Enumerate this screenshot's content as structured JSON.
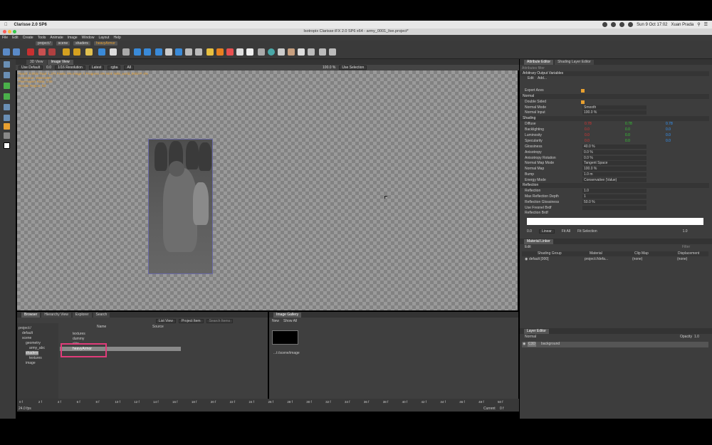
{
  "mac": {
    "app_name": "Clarisse 2.0 SP6",
    "menu": [
      "File",
      "Edit",
      "Create",
      "Tools",
      "Animate",
      "Image",
      "Window",
      "Layout",
      "Help"
    ],
    "clock": "Sun 9 Oct  17:02",
    "user": "Xuan Prada"
  },
  "window": {
    "title": "Isotropix Clarisse iFX 2.0 SP6 x64  -  army_0001_live.project*"
  },
  "pathbar": {
    "segments": [
      "project:/",
      "scene",
      "shaders"
    ],
    "current": "heavyArmor"
  },
  "viewer": {
    "tabs": [
      "3D View",
      "Image View"
    ],
    "options": [
      "Use Default",
      "0.0",
      "1/16 Resolution",
      "Latest",
      "rgba",
      "All"
    ],
    "zoom": "100.0 %",
    "selection": "Use Selection",
    "overlay_lines": [
      "Rendr: 0.003s Total: 1.37s Pixels: 0% Image: 0 Progress: 0% Hint: hello_world_0003 P: 0%",
      "Resolution: 1920x1080",
      "Pixel Aspect Ratio: 1.00",
      "Render Region: full"
    ]
  },
  "browser": {
    "tabs": [
      "Browser",
      "Hierarchy View",
      "Explorer",
      "Search"
    ],
    "view_mode": "List View",
    "filter": "Project Item",
    "search_placeholder": "Search Items",
    "columns": [
      "Name",
      "Source"
    ],
    "tree": [
      {
        "label": "project:/",
        "indent": 0
      },
      {
        "label": "default",
        "indent": 1
      },
      {
        "label": "scene",
        "indent": 1
      },
      {
        "label": "geometry",
        "indent": 2
      },
      {
        "label": "army_abc",
        "indent": 3
      },
      {
        "label": "shaders",
        "indent": 2,
        "selected": true
      },
      {
        "label": "textures",
        "indent": 3
      },
      {
        "label": "image",
        "indent": 2
      }
    ],
    "items": [
      {
        "name": "textures",
        "selected": false
      },
      {
        "name": "dummy",
        "selected": false
      },
      {
        "name": "skin",
        "selected": false
      },
      {
        "name": "heavyArmor",
        "selected": true
      }
    ]
  },
  "gallery": {
    "tab": "Image Gallery",
    "new_label": "New",
    "show_label": "Show All",
    "thumb_caption": "...t:/scene/image"
  },
  "timeline": {
    "ticks": [
      "0 f",
      "2 f",
      "4 f",
      "6 f",
      "8 f",
      "10 f",
      "12 f",
      "14 f",
      "16 f",
      "18 f",
      "20 f",
      "22 f",
      "24 f",
      "26 f",
      "28 f",
      "30 f",
      "32 f",
      "34 f",
      "36 f",
      "38 f",
      "40 f",
      "42 f",
      "44 f",
      "46 f",
      "48 f",
      "50 f"
    ],
    "fps": "24.0 fps",
    "start": "0 f",
    "end": "50 f",
    "current_label": "Current",
    "current_value": "0 f"
  },
  "attr_editor": {
    "tabs": [
      "Attribute Editor",
      "Shading Layer Editor"
    ],
    "filter_placeholder": "Attributes filter",
    "sections": {
      "arbitrary": "Arbitrary Output Variables",
      "edit": "Edit",
      "add": "Add...",
      "export": "Export Aovs",
      "normal": "Normal",
      "shading": "Shading",
      "reflection": "Reflection",
      "reflection_brdf": "Reflection Brdf"
    },
    "normal_rows": [
      {
        "label": "Double Sided",
        "value": ""
      },
      {
        "label": "Normal Mode",
        "value": "Smooth"
      },
      {
        "label": "Normal Input",
        "value": "100.0 %"
      }
    ],
    "shading_rows": [
      {
        "label": "Diffuse",
        "r": "0.78",
        "g": "0.78",
        "b": "0.78"
      },
      {
        "label": "Backlighting",
        "r": "0.0",
        "g": "0.0",
        "b": "0.0"
      },
      {
        "label": "Luminosity",
        "r": "0.0",
        "g": "0.0",
        "b": "0.0"
      },
      {
        "label": "Specularity",
        "r": "0.0",
        "g": "0.0",
        "b": "0.0"
      }
    ],
    "shading_values": [
      {
        "label": "Glossiness",
        "value": "40.0 %"
      },
      {
        "label": "Anisotropy",
        "value": "0.0 %"
      },
      {
        "label": "Anisotropy Rotation",
        "value": "0.0 %"
      },
      {
        "label": "Normal Map Mode",
        "value": "Tangent Space"
      },
      {
        "label": "Normal Map",
        "value": "100.0 %"
      },
      {
        "label": "Bump",
        "value": "1.0 m"
      },
      {
        "label": "Energy Mode",
        "value": "Conservative (Value)"
      }
    ],
    "reflection_rows": [
      {
        "label": "Reflection",
        "value": "1.0"
      },
      {
        "label": "Max Reflection Depth",
        "value": "1"
      },
      {
        "label": "Reflection Glossiness",
        "value": "50.0 %"
      },
      {
        "label": "Use Fresnel Brdf",
        "value": ""
      }
    ],
    "curve_controls": [
      "0.0",
      "Linear",
      "Fit All",
      "Fit Selection",
      "1.0"
    ]
  },
  "material_linker": {
    "title": "Material Linker",
    "edit": "Edit",
    "filter_placeholder": "Filter",
    "columns": [
      "Shading Group",
      "Material",
      "Clip Map",
      "Displacement"
    ],
    "row": {
      "group": "default [000]",
      "material": "project://defa...",
      "clip": "(none)",
      "disp": "(none)"
    }
  },
  "layer_editor": {
    "title": "Layer Editor",
    "mode": "Normal",
    "opacity_label": "Opacity",
    "opacity": "1.0",
    "layer_tag": "C3D",
    "layer_name": "background"
  },
  "colors": {
    "accent": "#e8a030",
    "highlight": "#e03c7a",
    "diffuse": "#d33"
  }
}
